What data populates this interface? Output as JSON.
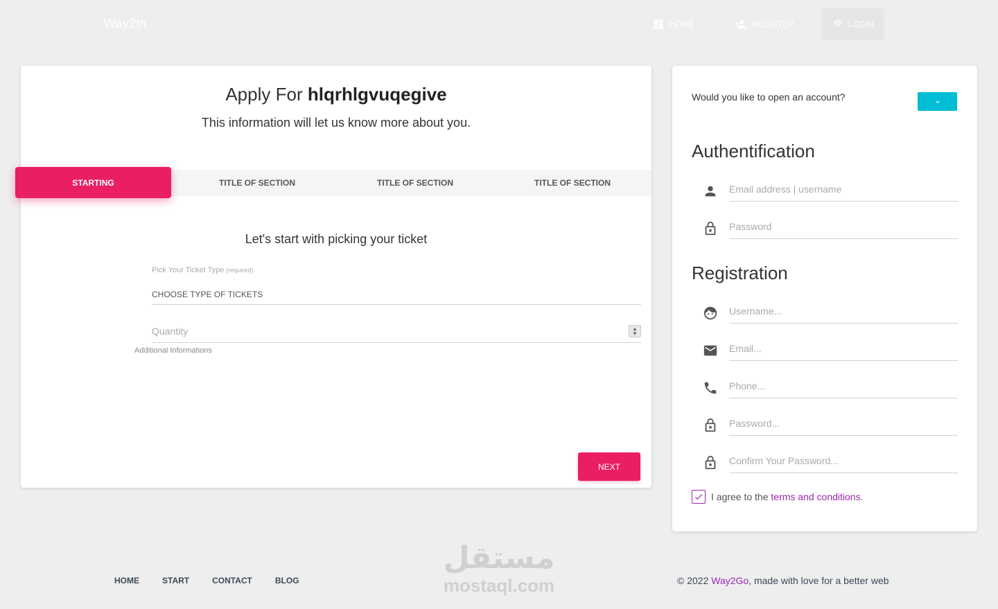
{
  "navbar": {
    "brand": "Way2In",
    "items": [
      {
        "label": "HOME",
        "icon": "dashboard-icon"
      },
      {
        "label": "REGISTER",
        "icon": "person-add-icon"
      },
      {
        "label": "LOGIN",
        "icon": "fingerprint-icon"
      }
    ]
  },
  "wizard": {
    "title_prefix": "Apply For",
    "title_name": "hlqrhlgvuqegive",
    "subtitle": "This information will let us know more about you.",
    "tabs": [
      "STARTING",
      "TITLE OF SECTION",
      "TITLE OF SECTION",
      "TITLE OF SECTION"
    ],
    "active_tab": 0,
    "section_title": "Let's start with picking your ticket",
    "ticket_label": "Pick Your Ticket Type",
    "ticket_required": "(required)",
    "ticket_value": "CHOOSE TYPE OF TICKETS",
    "quantity_placeholder": "Quantity",
    "additional": "Additional Informations",
    "next_label": "NEXT"
  },
  "side": {
    "open_question": "Would you like to open an account?",
    "auth_heading": "Authentification",
    "auth_fields": [
      {
        "icon": "person-icon",
        "placeholder": "Email address | username"
      },
      {
        "icon": "lock-icon",
        "placeholder": "Password"
      }
    ],
    "reg_heading": "Registration",
    "reg_fields": [
      {
        "icon": "face-icon",
        "placeholder": "Username..."
      },
      {
        "icon": "email-icon",
        "placeholder": "Email..."
      },
      {
        "icon": "phone-icon",
        "placeholder": "Phone..."
      },
      {
        "icon": "lock-icon",
        "placeholder": "Password..."
      },
      {
        "icon": "lock-icon",
        "placeholder": "Confirm Your Password..."
      }
    ],
    "agree_text": "I agree to the",
    "agree_link": "terms and conditions",
    "agree_suffix": ".",
    "agree_checked": true
  },
  "footer": {
    "links": [
      "HOME",
      "START",
      "CONTACT",
      "BLOG"
    ],
    "copyright_prefix": "© 2022",
    "copyright_brand": "Way2Go",
    "copyright_suffix": ", made with love for a better web"
  },
  "watermark": {
    "arabic": "مستقل",
    "latin": "mostaql.com"
  },
  "colors": {
    "primary": "#e91e63",
    "info": "#00bcd4",
    "link": "#9c27b0",
    "background": "#eeeeee"
  }
}
